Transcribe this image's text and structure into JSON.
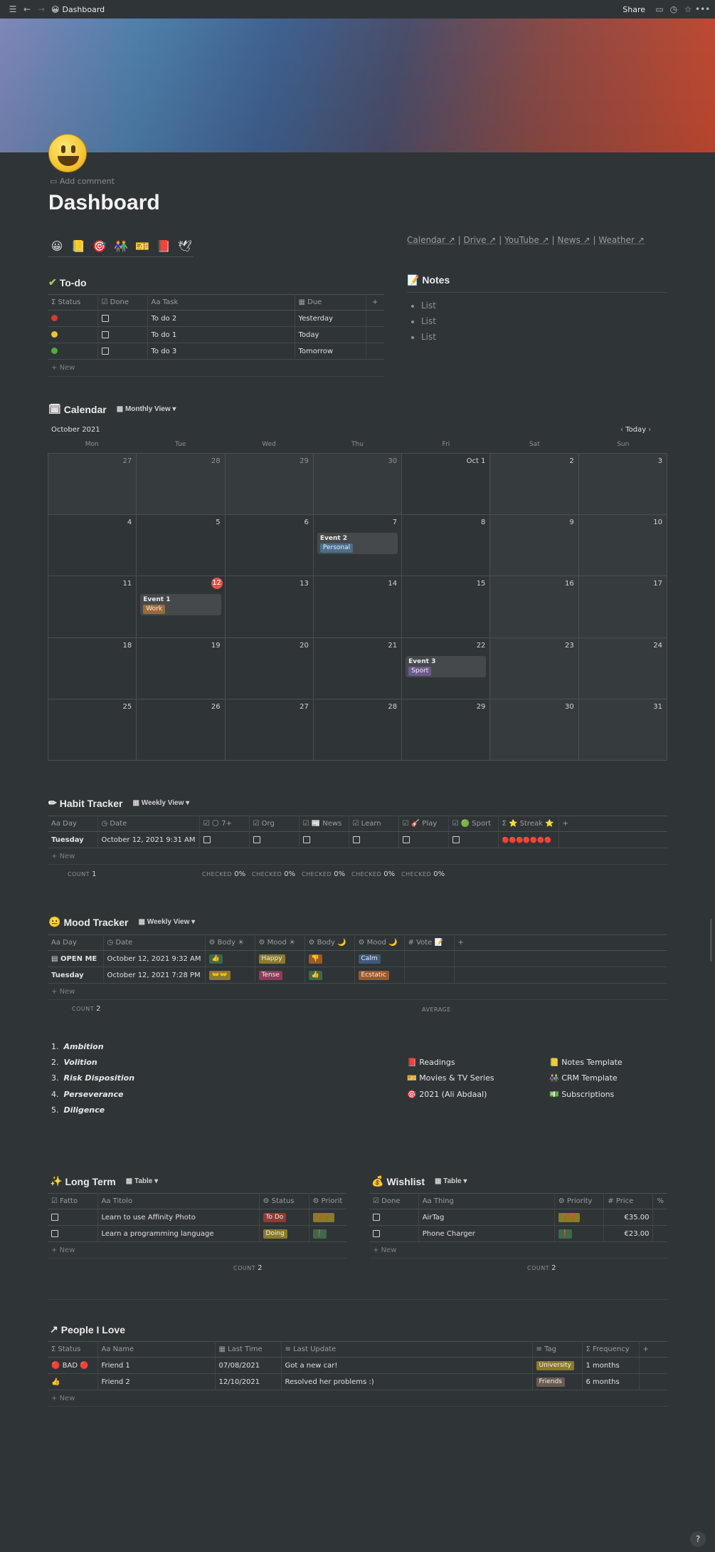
{
  "topbar": {
    "page_emoji": "😀",
    "page_name": "Dashboard",
    "share": "Share"
  },
  "page": {
    "title": "Dashboard",
    "add_comment": "Add comment"
  },
  "quick_icons": [
    "😀",
    "📒",
    "🎯",
    "👫",
    "🎫",
    "📕",
    "🕊"
  ],
  "links": [
    "Calendar ↗",
    "Drive ↗",
    "YouTube ↗",
    "News ↗",
    "Weather ↗"
  ],
  "todo": {
    "title": "To-do",
    "columns": [
      "Status",
      "Done",
      "Task",
      "Due"
    ],
    "rows": [
      {
        "status_color": "#d93a2b",
        "task": "To do 2",
        "due": "Yesterday"
      },
      {
        "status_color": "#f2c230",
        "task": "To do 1",
        "due": "Today"
      },
      {
        "status_color": "#4caf3a",
        "task": "To do 3",
        "due": "Tomorrow"
      }
    ],
    "new": "New"
  },
  "notes": {
    "title": "Notes",
    "items": [
      "List",
      "List",
      "List"
    ]
  },
  "calendar": {
    "title": "Calendar",
    "view": "Monthly View",
    "month": "October 2021",
    "today_btn": "Today",
    "weekdays": [
      "Mon",
      "Tue",
      "Wed",
      "Thu",
      "Fri",
      "Sat",
      "Sun"
    ],
    "cells": [
      "27",
      "28",
      "29",
      "30",
      "Oct 1",
      "2",
      "3",
      "4",
      "5",
      "6",
      "7",
      "8",
      "9",
      "10",
      "11",
      "12",
      "13",
      "14",
      "15",
      "16",
      "17",
      "18",
      "19",
      "20",
      "21",
      "22",
      "23",
      "24",
      "25",
      "26",
      "27",
      "28",
      "29",
      "30",
      "31"
    ],
    "events": [
      {
        "cell": 10,
        "name": "Event 2",
        "tag": "Personal",
        "color": "#4a6e8e"
      },
      {
        "cell": 15,
        "name": "Event 1",
        "tag": "Work",
        "color": "#9a6a3a"
      },
      {
        "cell": 25,
        "name": "Event 3",
        "tag": "Sport",
        "color": "#6b5a8e"
      }
    ]
  },
  "habit": {
    "title": "Habit Tracker",
    "view": "Weekly View",
    "columns": [
      "Day",
      "Date",
      "🌕 7+",
      "Org",
      "📰 News",
      "Learn",
      "🎸 Play",
      "🟢 Sport",
      "⭐ Streak ⭐"
    ],
    "row": {
      "day": "Tuesday",
      "date": "October 12, 2021 9:31 AM",
      "streak": "🔴🔴🔴🔴🔴🔴🔴"
    },
    "new": "New",
    "count_label": "COUNT",
    "count": "1",
    "checked_label": "CHECKED",
    "checked_value": "0%"
  },
  "mood": {
    "title": "Mood Tracker",
    "view": "Weekly View",
    "columns": [
      "Day",
      "Date",
      "Body ☀",
      "Mood ☀",
      "Body 🌙",
      "Mood 🌙",
      "Vote 📝"
    ],
    "rows": [
      {
        "day": "OPEN ME",
        "date": "October 12, 2021 9:32 AM",
        "body_am": "👍",
        "mood_am": "Happy",
        "body_pm": "👎",
        "mood_pm": "Calm"
      },
      {
        "day": "Tuesday",
        "date": "October 12, 2021 7:28 PM",
        "body_am": "👐👐",
        "mood_am": "Tense",
        "body_pm": "👍",
        "mood_pm": "Ecstatic"
      }
    ],
    "new": "New",
    "count_label": "COUNT",
    "count": "2",
    "average_label": "AVERAGE"
  },
  "values": [
    "Ambition",
    "Volition",
    "Risk Disposition",
    "Perseverance",
    "Diligence"
  ],
  "links_left": [
    "📕 Readings",
    "🎫 Movies & TV Series",
    "🎯 2021 (Ali Abdaal)"
  ],
  "links_right": [
    "📒 Notes Template",
    "👫 CRM Template",
    "💵 Subscriptions"
  ],
  "longterm": {
    "title": "Long Term",
    "view": "Table",
    "columns": [
      "Fatto",
      "Titolo",
      "Status",
      "Priorit"
    ],
    "rows": [
      {
        "title": "Learn to use Affinity Photo",
        "status": "To Do",
        "status_color": "#8e3b34",
        "priority": "❗❗",
        "p_color": "#8a7a2a"
      },
      {
        "title": "Learn a programming language",
        "status": "Doing",
        "status_color": "#8a7a2a",
        "priority": "❗",
        "p_color": "#3b6a4a"
      }
    ],
    "new": "New",
    "count_label": "COUNT",
    "count": "2"
  },
  "wishlist": {
    "title": "Wishlist",
    "view": "Table",
    "columns": [
      "Done",
      "Thing",
      "Priority",
      "Price"
    ],
    "rows": [
      {
        "thing": "AirTag",
        "priority": "❗❗",
        "p_color": "#8a7a2a",
        "price": "€35.00"
      },
      {
        "thing": "Phone Charger",
        "priority": "❗",
        "p_color": "#3b6a4a",
        "price": "€23.00"
      }
    ],
    "new": "New",
    "count_label": "COUNT",
    "count": "2"
  },
  "people": {
    "title": "People I Love",
    "columns": [
      "Status",
      "Name",
      "Last Time",
      "Last Update",
      "Tag",
      "Frequency"
    ],
    "rows": [
      {
        "status": "🔴 BAD 🔴",
        "name": "Friend 1",
        "last_time": "07/08/2021",
        "update": "Got a new car!",
        "tag": "University",
        "tag_color": "#8a7a2a",
        "freq": "1 months"
      },
      {
        "status": "👍",
        "name": "Friend 2",
        "last_time": "12/10/2021",
        "update": "Resolved her problems :)",
        "tag": "Friends",
        "tag_color": "#6a5b4f",
        "freq": "6 months"
      }
    ],
    "new": "New"
  },
  "help": "?"
}
